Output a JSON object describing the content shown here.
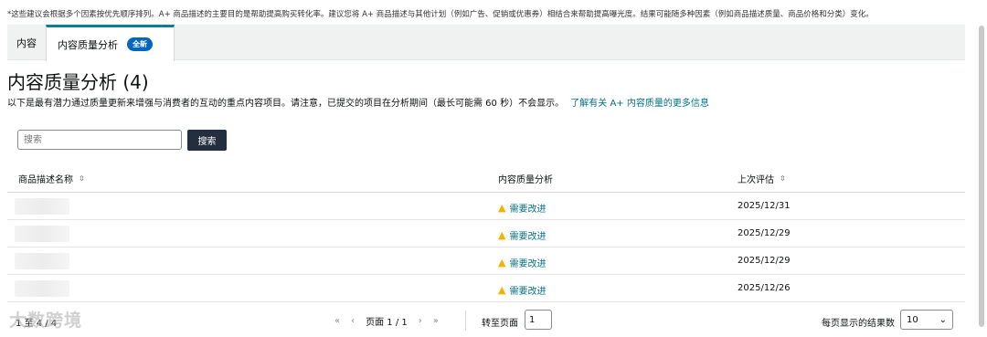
{
  "notice": "*这些建议会根据多个因素按优先顺序排列。A+ 商品描述的主要目的是帮助提高购买转化率。建议您将 A+ 商品描述与其他计划（例如广告、促销或优惠券）相结合来帮助提高曝光度。结果可能随多种因素（例如商品描述质量、商品价格和分类）变化。",
  "tabs": [
    {
      "label": "内容"
    },
    {
      "label": "内容质量分析",
      "badge": "全新"
    }
  ],
  "page_title": "内容质量分析 (4)",
  "subtitle": "以下是最有潜力通过质量更新来增强与消费者的互动的重点内容项目。请注意，已提交的项目在分析期间（最长可能需 60 秒）不会显示。",
  "learn_more_link": "了解有关 A+ 内容质量的更多信息",
  "search": {
    "placeholder": "搜索",
    "button_label": "搜索"
  },
  "table": {
    "columns": [
      "商品描述名称",
      "内容质量分析",
      "上次评估"
    ],
    "rows": [
      {
        "status": "需要改进",
        "date": "2025/12/31"
      },
      {
        "status": "需要改进",
        "date": "2025/12/29"
      },
      {
        "status": "需要改进",
        "date": "2025/12/29"
      },
      {
        "status": "需要改进",
        "date": "2025/12/26"
      }
    ]
  },
  "pagination": {
    "count": "1 至 4 / 4",
    "first": "«",
    "prev": "‹",
    "page_text": "页面 1 / 1",
    "next": "›",
    "last": "»",
    "goto_label": "转至页面",
    "goto_value": "1",
    "per_page_label": "每页显示的结果数",
    "per_page_value": "10"
  },
  "icons": {
    "sort": "sort-icon",
    "warning": "warning-icon",
    "dropdown": "chevron-down-icon"
  },
  "colors": {
    "accent": "#008296",
    "link": "#007185",
    "badge": "#0066c0",
    "button": "#232f3e",
    "warning": "#f0b400"
  },
  "watermark": "大数跨境"
}
